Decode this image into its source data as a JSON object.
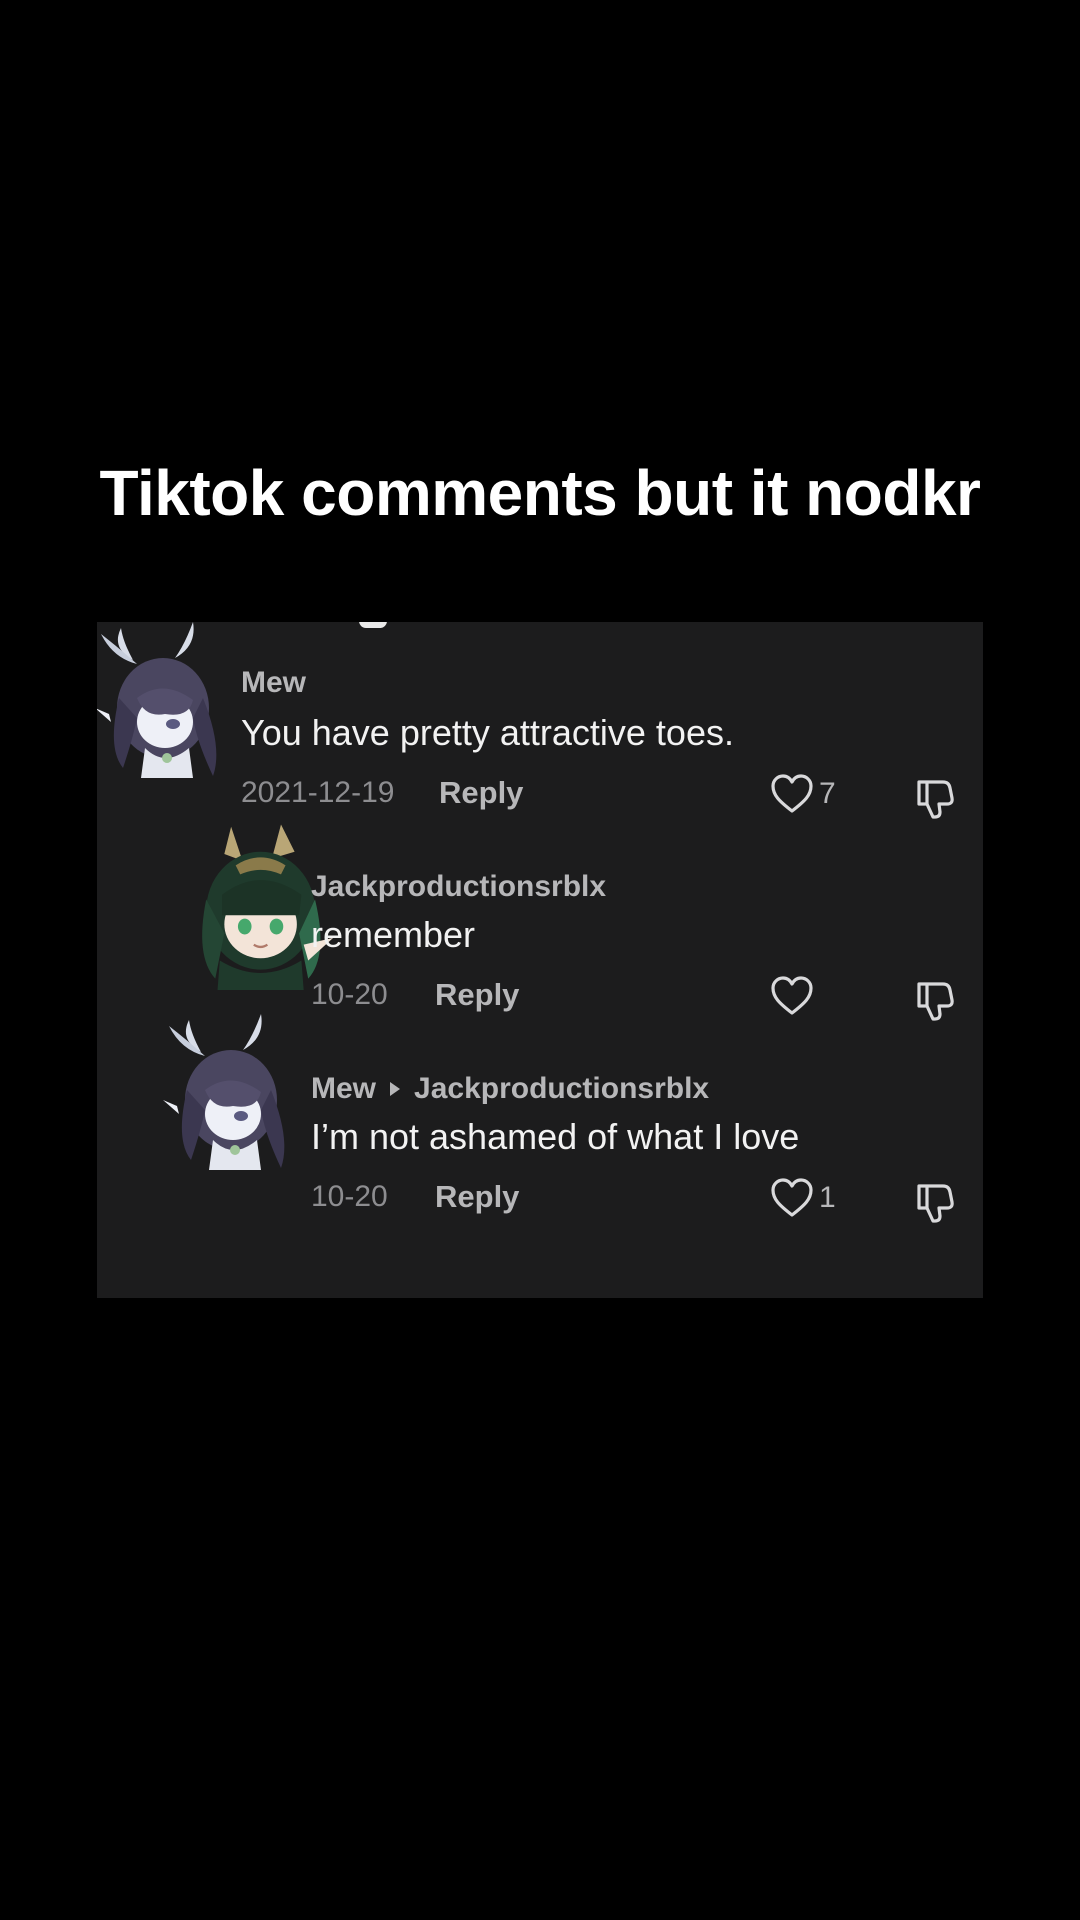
{
  "caption": "Tiktok comments but it nodkr",
  "comments": [
    {
      "username": "Mew",
      "reply_to": "",
      "text": "You have pretty attractive toes.",
      "date": "2021-12-19",
      "reply_label": "Reply",
      "likes": "7"
    },
    {
      "username": "Jackproductionsrblx",
      "reply_to": "",
      "text": "remember",
      "date": "10-20",
      "reply_label": "Reply",
      "likes": ""
    },
    {
      "username": "Mew",
      "reply_to": "Jackproductionsrblx",
      "text": "I’m not ashamed of what I love",
      "date": "10-20",
      "reply_label": "Reply",
      "likes": "1"
    }
  ],
  "colors": {
    "background": "#000000",
    "panel": "#1c1c1d",
    "username": "#b7b7b9",
    "text": "#f2f2f2",
    "date": "#8d8d90"
  },
  "icons": [
    "heart-icon",
    "dislike-icon",
    "reply-arrow-icon"
  ]
}
